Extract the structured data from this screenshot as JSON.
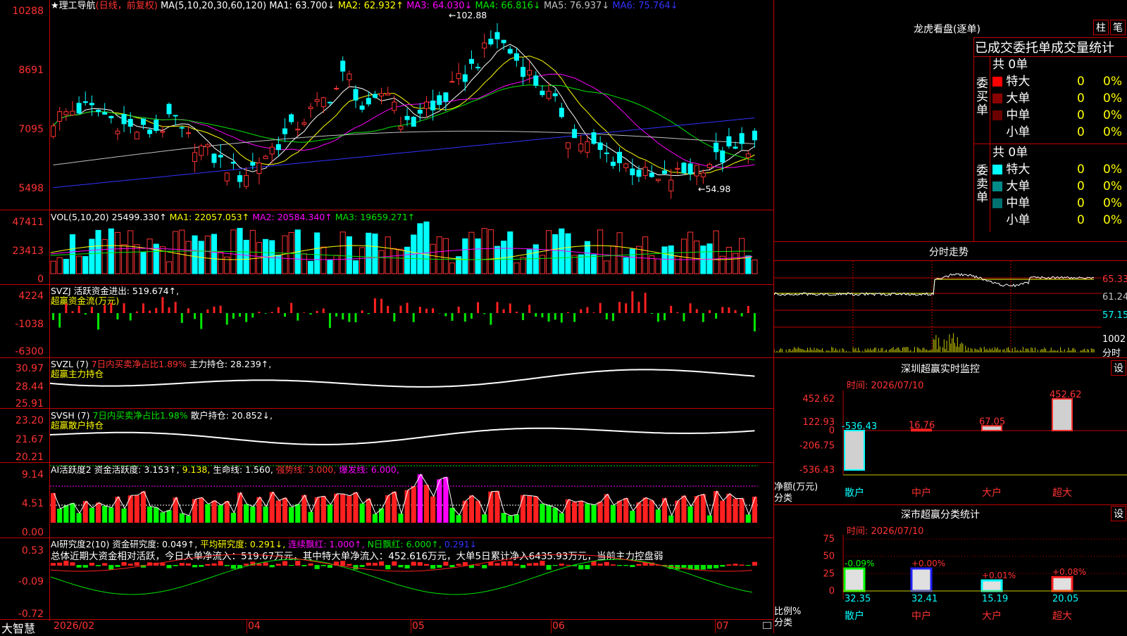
{
  "app": {
    "bottom_brand": "大智慧"
  },
  "main_chart": {
    "title_prefix": "★理工导航",
    "mode": "(日线，前复权)",
    "ma_label": "MA(5,10,20,30,60,120)",
    "ma1": "MA1: 63.700↓",
    "ma2": "MA2: 62.932↑",
    "ma3": "MA3: 64.030↓",
    "ma4": "MA4: 66.816↓",
    "ma5": "MA5: 76.937↓",
    "ma6": "MA6: 75.764↓",
    "high_note": "102.88",
    "low_note": "54.98",
    "y_ticks": [
      "10288",
      "8691",
      "7095",
      "5498"
    ]
  },
  "vol": {
    "label": "VOL(5,10,20)",
    "value": "25499.330↑",
    "ma1": "MA1: 22057.053↑",
    "ma2": "MA2: 20584.340↑",
    "ma3": "MA3: 19659.271↑",
    "y_ticks": [
      "47411",
      "23413",
      "0"
    ]
  },
  "svzj": {
    "label": "SVZJ",
    "desc": "活跃资金进出: 519.674↑,",
    "subtitle": "超赢资金流(万元)",
    "y_ticks": [
      "4224",
      "-1038",
      "-6300"
    ]
  },
  "svzl": {
    "label": "SVZL (7)",
    "ratio": "7日内买卖净占比1.89%",
    "value": "主力持仓: 28.239↑,",
    "subtitle": "超赢主力持仓",
    "y_ticks": [
      "30.97",
      "28.44",
      "25.91"
    ]
  },
  "svsh": {
    "label": "SVSH (7)",
    "ratio": "7日内买卖净占比1.98%",
    "value": "散户持仓: 20.852↓,",
    "subtitle": "超赢散户持仓",
    "y_ticks": [
      "23.20",
      "21.67",
      "20.21"
    ]
  },
  "ai_active": {
    "label": "AI活跃度2",
    "v1": "资金活跃度: 3.153↑,",
    "v2": "9.138,",
    "v3": "生命线: 1.560,",
    "v4": "强势线: 3.000,",
    "v5": "爆发线: 6.000,",
    "y_ticks": [
      "9.14",
      "4.51",
      "0.00"
    ]
  },
  "ai_research": {
    "label": "AI研究度2(10)",
    "v1": "资金研究度: 0.049↑,",
    "v2": "平均研究度: 0.291↓,",
    "v3": "连续飘红: 1.000↑,",
    "v4": "N日飘红: 6.000↑,",
    "v5": "0.291↓",
    "summary": "总体近期大资金相对活跃，今日大单净流入：519.67万元，其中特大单净流入：452.616万元，大单5日累计净入6435.93万元，当前主力控盘弱",
    "y_ticks": [
      "0.53",
      "-0.09",
      "-0.72"
    ]
  },
  "x_axis": [
    "2026/02",
    "04",
    "05",
    "06",
    "07"
  ],
  "dragon": {
    "title": "龙虎看盘(逐单)",
    "btn_bar": "柱",
    "btn_tick": "笔",
    "header": "已成交委托单成交量统计",
    "buy_label": "委买单",
    "sell_label": "委卖单",
    "buy_total": "共 0单",
    "sell_total": "共 0单",
    "rows": [
      "特大",
      "大单",
      "中单",
      "小单"
    ],
    "buy_colors": [
      "#ff0000",
      "#8b0000",
      "#6b0000",
      ""
    ],
    "sell_colors": [
      "#00ffff",
      "#008b8b",
      "#007070",
      ""
    ],
    "zero": "0",
    "pct": "0%"
  },
  "intraday": {
    "title": "分时走势",
    "y_ticks": [
      "65.33",
      "61.24",
      "57.15"
    ],
    "vol_tick": "1002",
    "vol_unit": "分时"
  },
  "monitor": {
    "title": "深圳超赢实时监控",
    "btn": "设",
    "time": "时间: 2026/07/10",
    "y_ticks": [
      "452.62",
      "122.93",
      "0",
      "-206.75",
      "-536.43"
    ],
    "y_unit": "净额(万元)",
    "x_unit": "分类",
    "categories": [
      "散户",
      "中户",
      "大户",
      "超大"
    ],
    "values": [
      -536.43,
      16.76,
      67.05,
      452.62
    ],
    "labels": [
      "-536.43",
      "16.76",
      "67.05",
      "452.62"
    ]
  },
  "classify": {
    "title": "深市超赢分类统计",
    "btn": "设",
    "time": "时间: 2026/07/10",
    "y_ticks": [
      "75",
      "50",
      "25",
      "0"
    ],
    "y_unit": "比例%",
    "x_unit": "分类",
    "categories": [
      "散户",
      "中户",
      "大户",
      "超大"
    ],
    "values": [
      32.35,
      32.41,
      15.19,
      20.05
    ],
    "values_text": [
      "32.35",
      "32.41",
      "15.19",
      "20.05"
    ],
    "changes": [
      "-0.09%",
      "+0.00%",
      "+0.01%",
      "+0.08%"
    ]
  }
}
